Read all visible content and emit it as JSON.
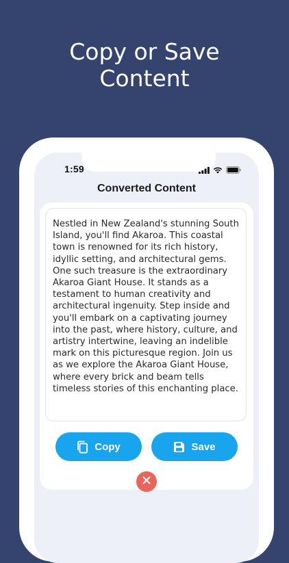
{
  "headline": {
    "line1": "Copy or Save",
    "line2": "Content"
  },
  "status_bar": {
    "time": "1:59",
    "icons": [
      "signal-icon",
      "wifi-icon",
      "battery-icon"
    ]
  },
  "screen": {
    "title": "Converted Content",
    "content_text": "Nestled in New Zealand's stunning South Island, you'll find Akaroa. This coastal town is renowned for its rich history, idyllic setting, and architectural gems. One such treasure is the extraordinary Akaroa Giant House. It stands as a testament to human creativity and architectural ingenuity. Step inside and you'll embark on a captivating journey into the past, where history, culture, and artistry intertwine, leaving an indelible mark on this picturesque region. Join us as we explore the Akaroa Giant House, where every brick and beam tells timeless stories of this enchanting place.",
    "buttons": {
      "copy_label": "Copy",
      "save_label": "Save"
    }
  },
  "colors": {
    "background": "#35446f",
    "accent": "#19a4ee",
    "close": "#e8655a",
    "screen_bg": "#eef0f8"
  }
}
